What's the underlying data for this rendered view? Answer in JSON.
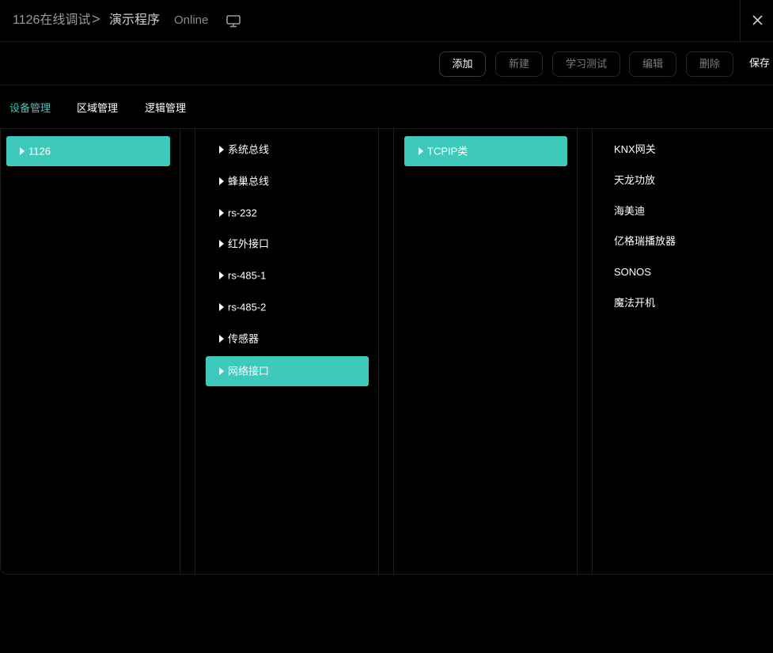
{
  "header": {
    "breadcrumb_root": "1126在线调试",
    "separator": ">",
    "program": "演示程序",
    "status": "Online",
    "icons": {
      "monitor": "monitor-icon",
      "close": "close-icon"
    }
  },
  "toolbar": {
    "add": "添加",
    "new": "新建",
    "learn_test": "学习测试",
    "edit": "编辑",
    "delete": "删除",
    "save": "保存"
  },
  "tabs": [
    {
      "label": "设备管理",
      "active": true
    },
    {
      "label": "区域管理",
      "active": false
    },
    {
      "label": "逻辑管理",
      "active": false
    }
  ],
  "columns": {
    "hosts": [
      "1126"
    ],
    "interfaces": [
      "系统总线",
      "蜂巢总线",
      "rs-232",
      "红外接口",
      "rs-485-1",
      "rs-485-2",
      "传感器",
      "网络接口"
    ],
    "categories": [
      "TCPIP类"
    ],
    "devices": [
      "KNX网关",
      "天龙功放",
      "海美迪",
      "亿格瑞播放器",
      "SONOS",
      "魔法开机"
    ]
  },
  "colors": {
    "accent": "#3ec9bb",
    "background": "#000000",
    "divider": "#1e1e1e"
  }
}
